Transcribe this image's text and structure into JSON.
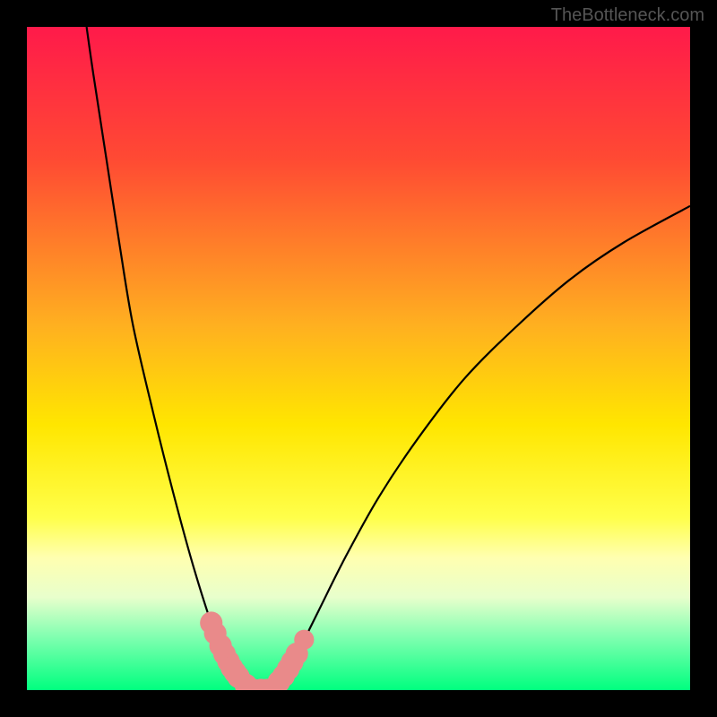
{
  "watermark": "TheBottleneck.com",
  "chart_data": {
    "type": "line",
    "title": "",
    "xlabel": "",
    "ylabel": "",
    "xlim": [
      0,
      100
    ],
    "ylim": [
      0,
      100
    ],
    "gradient_stops": [
      {
        "offset": 0,
        "color": "#ff1a4a"
      },
      {
        "offset": 20,
        "color": "#ff4a33"
      },
      {
        "offset": 45,
        "color": "#ffb020"
      },
      {
        "offset": 60,
        "color": "#ffe600"
      },
      {
        "offset": 74,
        "color": "#ffff4a"
      },
      {
        "offset": 80,
        "color": "#ffffb0"
      },
      {
        "offset": 86,
        "color": "#e8ffcc"
      },
      {
        "offset": 92,
        "color": "#80ffb0"
      },
      {
        "offset": 100,
        "color": "#00ff7f"
      }
    ],
    "series": [
      {
        "name": "bottleneck-curve-left",
        "x": [
          9,
          10,
          12,
          14,
          16,
          19,
          22,
          25,
          28,
          29.5,
          31,
          32.5,
          34
        ],
        "values": [
          100,
          93,
          80,
          67,
          55,
          42,
          30,
          19,
          9.5,
          6,
          3.2,
          1.2,
          0
        ]
      },
      {
        "name": "bottleneck-curve-right",
        "x": [
          37,
          39,
          41,
          44,
          48,
          53,
          59,
          66,
          74,
          82,
          90,
          100
        ],
        "values": [
          0,
          2.5,
          6,
          12,
          20,
          29,
          38,
          47,
          55,
          62,
          67.5,
          73
        ]
      }
    ],
    "flat_segment": {
      "x0": 34,
      "x1": 37,
      "y": 0
    },
    "markers_left": [
      27.8,
      28.4,
      29.2,
      29.8,
      30.4,
      30.9,
      31.4,
      31.9,
      33.0,
      34.2,
      35.3
    ],
    "markers_right": [
      36.2,
      37.2,
      38.0,
      38.7,
      39.4,
      40.0,
      40.7
    ],
    "marker_outlier_right_x": 41.8,
    "marker_color": "#e98a8a",
    "marker_radius": 1.7,
    "marker_radius_outlier": 1.5
  }
}
